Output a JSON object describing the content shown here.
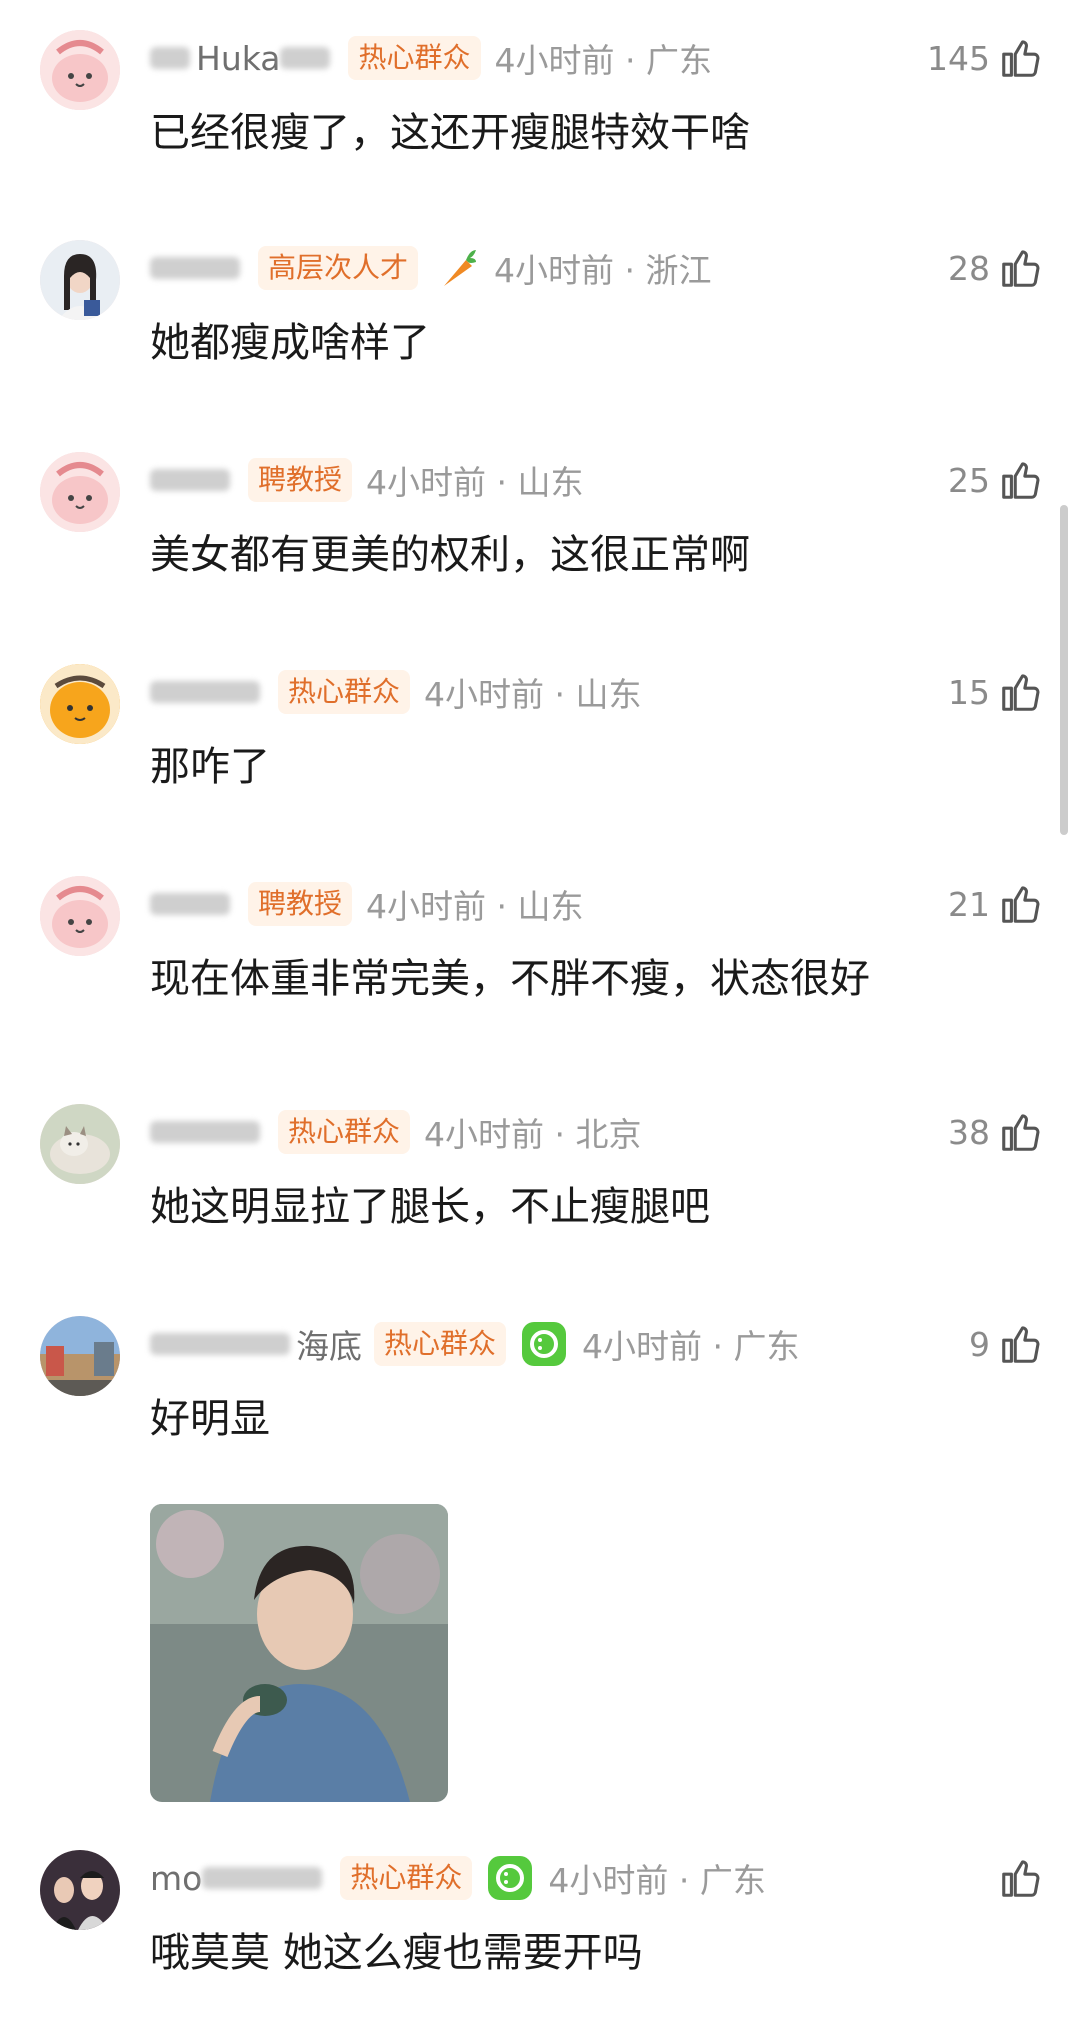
{
  "colors": {
    "badge_text": "#e06f2b",
    "badge_bg": "#fff3e8",
    "meta": "#9a9a9a",
    "text": "#1a1a1a"
  },
  "comments": [
    {
      "user": "Huka",
      "badge": "热心群众",
      "time": "4小时前 · 广东",
      "likes": "145",
      "text": "已经很瘦了，这还开瘦腿特效干啥",
      "avatar": "pink-mascot-avatar"
    },
    {
      "user": "",
      "badge": "高层次人才",
      "medal": "carrot-medal",
      "time": "4小时前 · 浙江",
      "likes": "28",
      "text": "她都瘦成啥样了",
      "avatar": "woman-photo-avatar"
    },
    {
      "user": "",
      "badge": "聘教授",
      "time": "4小时前 · 山东",
      "likes": "25",
      "text": "美女都有更美的权利，这很正常啊",
      "avatar": "pink-mascot-avatar"
    },
    {
      "user": "",
      "badge": "热心群众",
      "time": "4小时前 · 山东",
      "likes": "15",
      "text": "那咋了",
      "avatar": "orange-mascot-avatar"
    },
    {
      "user": "",
      "badge": "聘教授",
      "time": "4小时前 · 山东",
      "likes": "21",
      "text": "现在体重非常完美，不胖不瘦，状态很好",
      "avatar": "pink-mascot-avatar"
    },
    {
      "user": "",
      "badge": "热心群众",
      "time": "4小时前 · 北京",
      "likes": "38",
      "text": "她这明显拉了腿长，不止瘦腿吧",
      "avatar": "cat-photo-avatar"
    },
    {
      "user": "海底",
      "badge": "热心群众",
      "medal": "green-smile-medal",
      "time": "4小时前 · 广东",
      "likes": "9",
      "text": "好明显",
      "avatar": "street-photo-avatar",
      "image": "drinking-man-photo"
    },
    {
      "user": "mo",
      "badge": "热心群众",
      "medal": "green-smile-medal",
      "time": "4小时前 · 广东",
      "likes": "",
      "text": "哦莫莫 她这么瘦也需要开吗",
      "avatar": "group-photo-avatar"
    }
  ]
}
